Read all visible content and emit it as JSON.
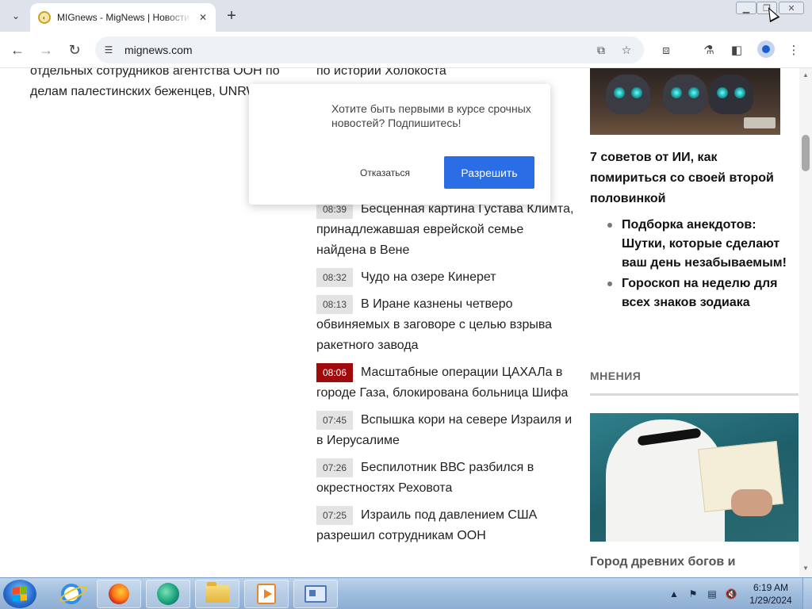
{
  "browser": {
    "tab_title": "MIGnews - MigNews | Новости",
    "new_tab_symbol": "+",
    "url": "mignews.com"
  },
  "left_column": {
    "text": "отдельных сотрудников агентства ООН по делам палестинских беженцев, UNRWA"
  },
  "news_feed": [
    {
      "time": "",
      "title": "по истории Холокоста",
      "hot": false
    },
    {
      "time": "08:39",
      "title": "Бесценная картина Густава Климта, принадлежавшая еврейской семье найдена в Вене",
      "hot": false
    },
    {
      "time": "08:32",
      "title": "Чудо на озере Кинерет",
      "hot": false
    },
    {
      "time": "08:13",
      "title": "В Иране казнены четверо обвиняемых в заговоре с целью взрыва ракетного завода",
      "hot": false
    },
    {
      "time": "08:06",
      "title": "Масштабные операции ЦАХАЛа в городе Газа, блокирована больница Шифа",
      "hot": true
    },
    {
      "time": "07:45",
      "title": "Вспышка кори на севере Израиля и в Иерусалиме",
      "hot": false
    },
    {
      "time": "07:26",
      "title": "Беспилотник ВВС разбился в окрестностях Реховота",
      "hot": false
    },
    {
      "time": "07:25",
      "title": "Израиль под давлением США разрешил сотрудникам ООН",
      "hot": false
    }
  ],
  "right_column": {
    "feature_title": "7 советов от ИИ, как помириться со своей второй половинкой",
    "links": [
      "Подборка анекдотов: Шутки, которые сделают ваш день незабываемым!",
      "Гороскоп на неделю для всех знаков зодиака"
    ],
    "section_heading": "МНЕНИЯ",
    "opinion_title": "Город древних богов и"
  },
  "notification_prompt": {
    "message": "Хотите быть первыми в курсе срочных новостей? Подпишитесь!",
    "decline_label": "Отказаться",
    "allow_label": "Разрешить"
  },
  "taskbar": {
    "time": "6:19 AM",
    "date": "1/29/2024"
  },
  "colors": {
    "accent_blue": "#2b6de5",
    "hot_badge": "#a10a0a",
    "badge_gray": "#e3e3e3"
  }
}
